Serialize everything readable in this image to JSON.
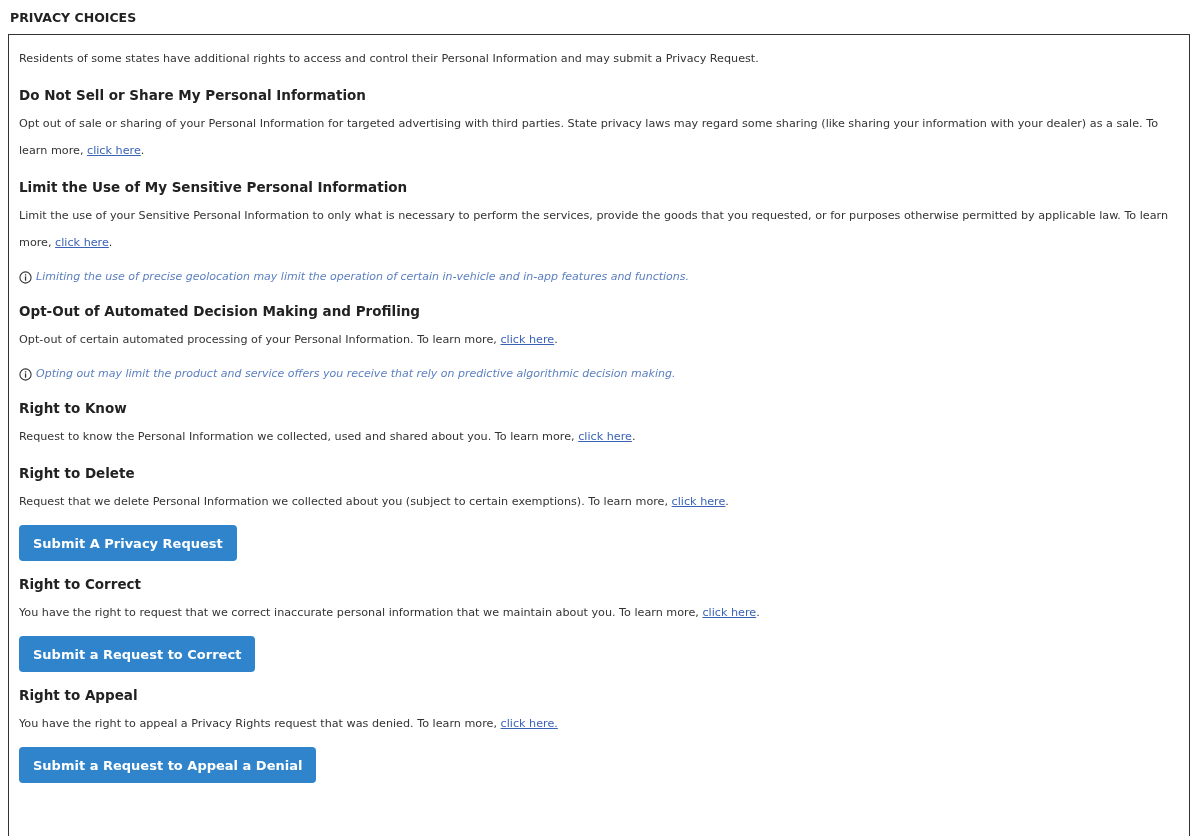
{
  "title": "PRIVACY CHOICES",
  "blocks": [
    {
      "kind": "text",
      "text": "Residents of some states have additional rights to access and control their Personal Information and may submit a Privacy Request."
    },
    {
      "kind": "heading",
      "text": "Do Not Sell or Share My Personal Information"
    },
    {
      "kind": "text",
      "text": "Opt out of sale or sharing of your Personal Information for targeted advertising with third parties. State privacy laws may regard some sharing (like sharing your information with your dealer) as a sale. To learn more, ",
      "link": "click here",
      "after": "."
    },
    {
      "kind": "heading",
      "text": "Limit the Use of My Sensitive Personal Information"
    },
    {
      "kind": "text",
      "text": "Limit the use of your Sensitive Personal Information to only what is necessary to perform the services, provide the goods that you requested, or for purposes otherwise permitted by applicable law. To learn more, ",
      "link": "click here",
      "after": "."
    },
    {
      "kind": "note",
      "text": "Limiting the use of precise geolocation may limit the operation of certain in-vehicle and in-app features and functions."
    },
    {
      "kind": "heading",
      "text": "Opt-Out of Automated Decision Making and Profiling"
    },
    {
      "kind": "text",
      "text": "Opt-out of certain automated processing of your Personal Information. To learn more, ",
      "link": "click here",
      "after": "."
    },
    {
      "kind": "note",
      "text": "Opting out may limit the product and service offers you receive that rely on predictive algorithmic decision making."
    },
    {
      "kind": "heading",
      "text": "Right to Know"
    },
    {
      "kind": "text",
      "text": "Request to know the Personal Information we collected, used and shared about you. To learn more, ",
      "link": "click here",
      "after": "."
    },
    {
      "kind": "heading",
      "text": "Right to Delete"
    },
    {
      "kind": "text",
      "text": "Request that we delete Personal Information we collected about you (subject to certain exemptions). To learn more, ",
      "link": "click here",
      "after": "."
    },
    {
      "kind": "button",
      "text": "Submit A Privacy Request"
    },
    {
      "kind": "heading",
      "text": "Right to Correct"
    },
    {
      "kind": "text",
      "text": "You have the right to request that we correct inaccurate personal information that we maintain about you. To learn more, ",
      "link": "click here",
      "after": "."
    },
    {
      "kind": "button",
      "text": "Submit a Request to Correct"
    },
    {
      "kind": "heading",
      "text": "Right to Appeal"
    },
    {
      "kind": "text",
      "text": "You have the right to appeal a Privacy Rights request that was denied. To learn more, ",
      "link": "click here."
    },
    {
      "kind": "button",
      "text": "Submit a Request to Appeal a Denial"
    }
  ]
}
